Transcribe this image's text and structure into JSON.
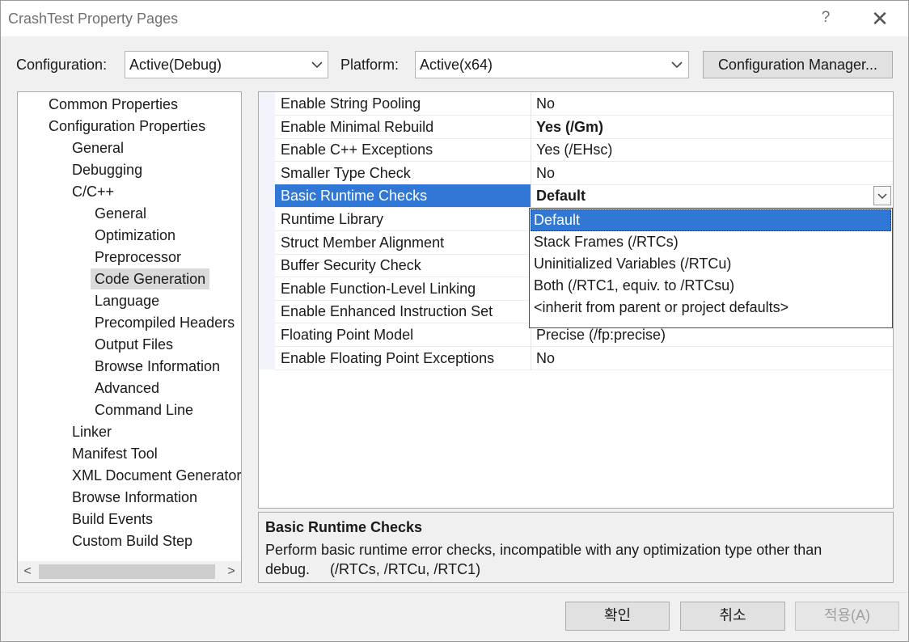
{
  "window": {
    "title": "CrashTest Property Pages",
    "help_glyph": "?",
    "close_glyph": "✕"
  },
  "toolbar": {
    "configuration_label": "Configuration:",
    "configuration_value": "Active(Debug)",
    "platform_label": "Platform:",
    "platform_value": "Active(x64)",
    "config_manager_label": "Configuration Manager..."
  },
  "tree": {
    "items": [
      {
        "label": "Common Properties",
        "level": 1
      },
      {
        "label": "Configuration Properties",
        "level": 1
      },
      {
        "label": "General",
        "level": 2
      },
      {
        "label": "Debugging",
        "level": 2
      },
      {
        "label": "C/C++",
        "level": 2
      },
      {
        "label": "General",
        "level": 3
      },
      {
        "label": "Optimization",
        "level": 3
      },
      {
        "label": "Preprocessor",
        "level": 3
      },
      {
        "label": "Code Generation",
        "level": 3,
        "selected": true
      },
      {
        "label": "Language",
        "level": 3
      },
      {
        "label": "Precompiled Headers",
        "level": 3
      },
      {
        "label": "Output Files",
        "level": 3
      },
      {
        "label": "Browse Information",
        "level": 3
      },
      {
        "label": "Advanced",
        "level": 3
      },
      {
        "label": "Command Line",
        "level": 3
      },
      {
        "label": "Linker",
        "level": 2
      },
      {
        "label": "Manifest Tool",
        "level": 2
      },
      {
        "label": "XML Document Generator",
        "level": 2
      },
      {
        "label": "Browse Information",
        "level": 2
      },
      {
        "label": "Build Events",
        "level": 2
      },
      {
        "label": "Custom Build Step",
        "level": 2
      }
    ],
    "scroll_left": "<",
    "scroll_right": ">"
  },
  "properties": [
    {
      "name": "Enable String Pooling",
      "value": "No"
    },
    {
      "name": "Enable Minimal Rebuild",
      "value": "Yes (/Gm)",
      "bold": true
    },
    {
      "name": "Enable C++ Exceptions",
      "value": "Yes (/EHsc)"
    },
    {
      "name": "Smaller Type Check",
      "value": "No"
    },
    {
      "name": "Basic Runtime Checks",
      "value": "Default",
      "selected": true
    },
    {
      "name": "Runtime Library",
      "value": ""
    },
    {
      "name": "Struct Member Alignment",
      "value": ""
    },
    {
      "name": "Buffer Security Check",
      "value": ""
    },
    {
      "name": "Enable Function-Level Linking",
      "value": ""
    },
    {
      "name": "Enable Enhanced Instruction Set",
      "value": ""
    },
    {
      "name": "Floating Point Model",
      "value": "Precise (/fp:precise)"
    },
    {
      "name": "Enable Floating Point Exceptions",
      "value": "No"
    }
  ],
  "dropdown": {
    "options": [
      {
        "label": "Default",
        "selected": true
      },
      {
        "label": "Stack Frames (/RTCs)"
      },
      {
        "label": "Uninitialized Variables (/RTCu)"
      },
      {
        "label": "Both (/RTC1, equiv. to /RTCsu)"
      },
      {
        "label": "<inherit from parent or project defaults>"
      }
    ]
  },
  "description": {
    "title": "Basic Runtime Checks",
    "body": "Perform basic runtime error checks, incompatible with any optimization type other than\ndebug.     (/RTCs, /RTCu, /RTC1)"
  },
  "buttons": {
    "ok": "확인",
    "cancel": "취소",
    "apply": "적용(A)"
  },
  "colors": {
    "selection": "#3077d6",
    "tree_selection": "#dadada"
  }
}
